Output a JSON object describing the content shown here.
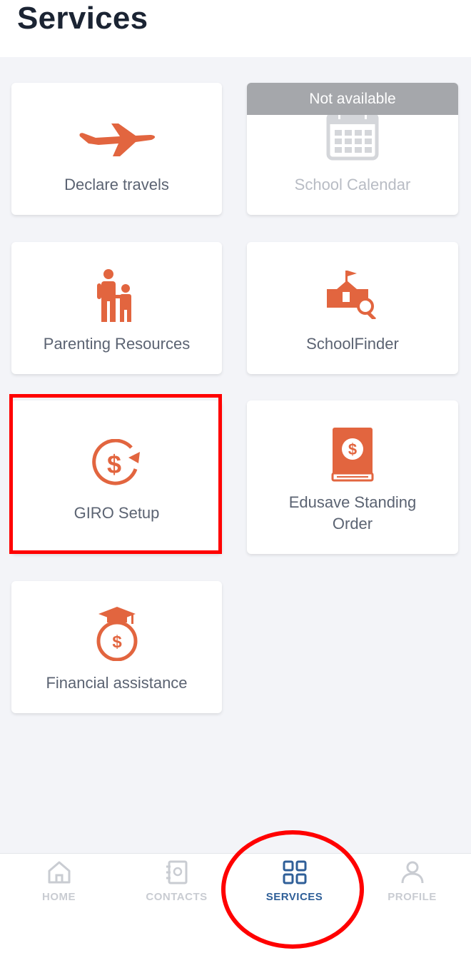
{
  "header": {
    "title": "Services"
  },
  "services": {
    "declare_travels": {
      "label": "Declare travels",
      "icon": "airplane-icon"
    },
    "school_calendar": {
      "label": "School Calendar",
      "icon": "calendar-icon",
      "banner": "Not available"
    },
    "parenting_resources": {
      "label": "Parenting Resources",
      "icon": "parent-child-icon"
    },
    "school_finder": {
      "label": "SchoolFinder",
      "icon": "school-search-icon"
    },
    "giro_setup": {
      "label": "GIRO Setup",
      "icon": "dollar-cycle-icon"
    },
    "edusave": {
      "label_line1": "Edusave Standing",
      "label_line2": "Order",
      "icon": "dollar-book-icon"
    },
    "financial_assistance": {
      "label": "Financial assistance",
      "icon": "graduation-money-bag-icon"
    }
  },
  "tabbar": {
    "home": {
      "label": "HOME",
      "icon": "home-icon"
    },
    "contacts": {
      "label": "CONTACTS",
      "icon": "contacts-book-icon"
    },
    "services": {
      "label": "SERVICES",
      "icon": "grid-icon"
    },
    "profile": {
      "label": "PROFILE",
      "icon": "person-icon"
    }
  },
  "colors": {
    "accent": "#e2653f",
    "active_tab": "#2f5f98",
    "inactive_tab": "#c9ccd2",
    "annotation": "#ff0000"
  }
}
